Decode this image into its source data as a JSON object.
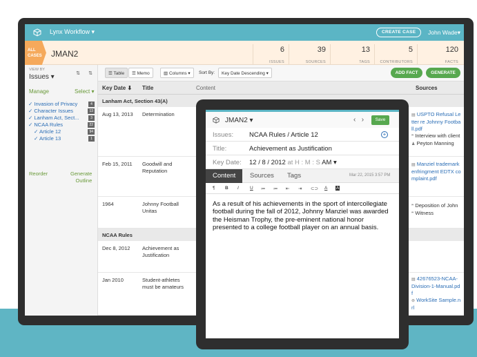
{
  "app": {
    "workflow": "Lynx Workflow",
    "workflow_caret": "▾",
    "create_case": "CREATE CASE",
    "user": "John Wade",
    "user_caret": "▾"
  },
  "case": {
    "all_cases_line1": "ALL",
    "all_cases_line2": "CASES",
    "name": "JMAN2",
    "stats": [
      {
        "value": "6",
        "label": "ISSUES"
      },
      {
        "value": "39",
        "label": "SOURCES"
      },
      {
        "value": "13",
        "label": "TAGS"
      },
      {
        "value": "5",
        "label": "CONTRIBUTORS"
      },
      {
        "value": "120",
        "label": "FACTS"
      }
    ]
  },
  "sidebar": {
    "view_by": "VIEW BY",
    "view_value": "Issues ▾",
    "sort_a": "⇅",
    "sort_b": "⇅",
    "manage": "Manage",
    "select": "Select ▾",
    "items": [
      {
        "label": "✓ Invasion of Privacy",
        "count": "4"
      },
      {
        "label": "✓ Character Issues",
        "count": "13"
      },
      {
        "label": "✓ Lanham Act, Sect...",
        "count": "3"
      },
      {
        "label": "✓ NCAA Rules",
        "count": "22"
      },
      {
        "label": "✓ Article 12",
        "count": "94"
      },
      {
        "label": "✓ Article 13",
        "count": "1"
      }
    ],
    "reorder": "Reorder",
    "generate_line1": "Generate",
    "generate_line2": "Outline",
    "warning": "⚠"
  },
  "toolbar": {
    "table": "☰ Table",
    "memo": "☰ Memo",
    "columns": "▥ Columns ▾",
    "sort_by": "Sort By:",
    "sort_value": "Key Date Descending ▾",
    "add_fact": "ADD FACT",
    "generate": "GENERATE"
  },
  "table": {
    "headers": {
      "key_date": "Key Date ⬇",
      "title": "Title",
      "content": "Content",
      "sources": "Sources"
    },
    "groups": [
      "Lanham Act, Section 43(A)",
      "NCAA Rules"
    ],
    "rows": [
      {
        "date": "Aug 13, 2013",
        "title": "Determination"
      },
      {
        "date": "Feb 15, 2011",
        "title": "Goodwill and Reputation"
      },
      {
        "date": "1964",
        "title": "Johnny Football Unitas"
      },
      {
        "date": "Dec 8, 2012",
        "title": "Achievement as Justification"
      },
      {
        "date": "Jan 2010",
        "title": "Student-athletes must be amateurs"
      }
    ],
    "sources": {
      "r1_a": "USPTO Refusal Letter re Johnny Football.pdf",
      "r1_b": "Interview with client",
      "r1_c": "Peyton Manning",
      "r2_a": "Manziel trademark enfringment EDTX complaint.pdf",
      "r3_a": "Deposition of John",
      "r3_b": "Witness",
      "r5_a": "42676523-NCAA-Division-1-Manual.pdf",
      "r5_b": "WorkSite Sample.nrl"
    },
    "icons": {
      "doc": "▤",
      "quote": "❞",
      "person": "♟",
      "link": "⊚"
    }
  },
  "detail": {
    "case": "JMAN2 ▾",
    "prev": "‹",
    "next": "›",
    "save": "Save",
    "issues_label": "Issues:",
    "issues_value": "NCAA Rules / Article 12",
    "title_label": "Title:",
    "title_value": "Achievement as Justification",
    "keydate_label": "Key Date:",
    "keydate_value": "12 / 8  / 2012",
    "keydate_at": "at  H : M : S",
    "keydate_ampm": "AM ▾",
    "tabs": [
      "Content",
      "Sources",
      "Tags"
    ],
    "timestamp": "Mar 22, 2015 3:57 PM",
    "format_tools": [
      "¶",
      "B",
      "I",
      "U",
      "≔",
      "≔",
      "⇤",
      "⇥",
      "⊂⊃",
      "A",
      "A"
    ],
    "content": "As a result of his achievements in the sport of intercollegiate football during the fall of 2012, Johnny Manziel was awarded the Heisman Trophy, the pre-eminent national honor presented to a college football player on an annual basis."
  },
  "colors": {
    "teal": "#5bb5c5",
    "green": "#57a84f",
    "orange": "#f5a95b",
    "link": "#2a6db5"
  }
}
